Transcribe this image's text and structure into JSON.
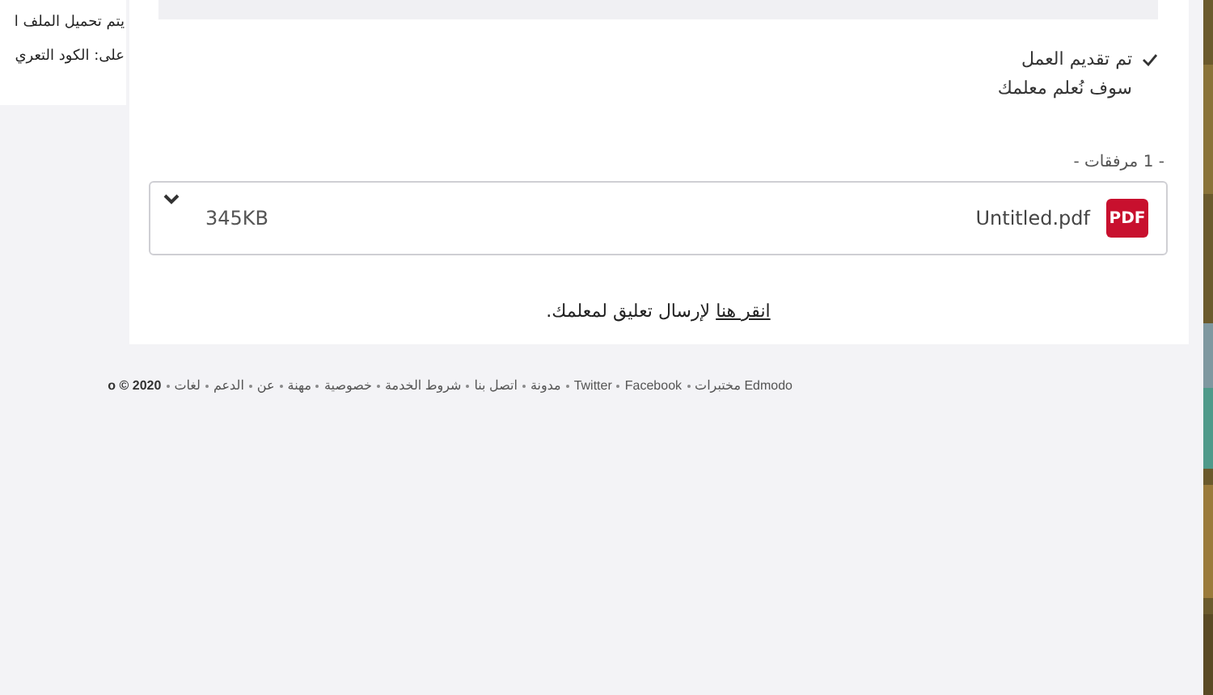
{
  "side_panel": {
    "lines": [
      "يتم تحميل الملف ا",
      "على: الكود التعري"
    ]
  },
  "submission": {
    "status": "تم تقديم العمل",
    "note": "سوف نُعلم معلمك",
    "submitted": true
  },
  "attachments": {
    "label": "- 1 مرفقات -",
    "files": [
      {
        "badge": "PDF",
        "name": "Untitled.pdf",
        "size": "345KB",
        "expanded": false
      }
    ]
  },
  "comment_prompt": {
    "link": "انقر هنا",
    "rest": " لإرسال تعليق لمعلمك."
  },
  "footer": {
    "links": [
      "Edmodo مختبرات",
      "Facebook",
      "Twitter",
      "مدونة",
      "اتصل بنا",
      "شروط الخدمة",
      "خصوصية",
      "مهنة",
      "عن",
      "الدعم",
      "لغات"
    ],
    "copyright": "o © 2020"
  }
}
